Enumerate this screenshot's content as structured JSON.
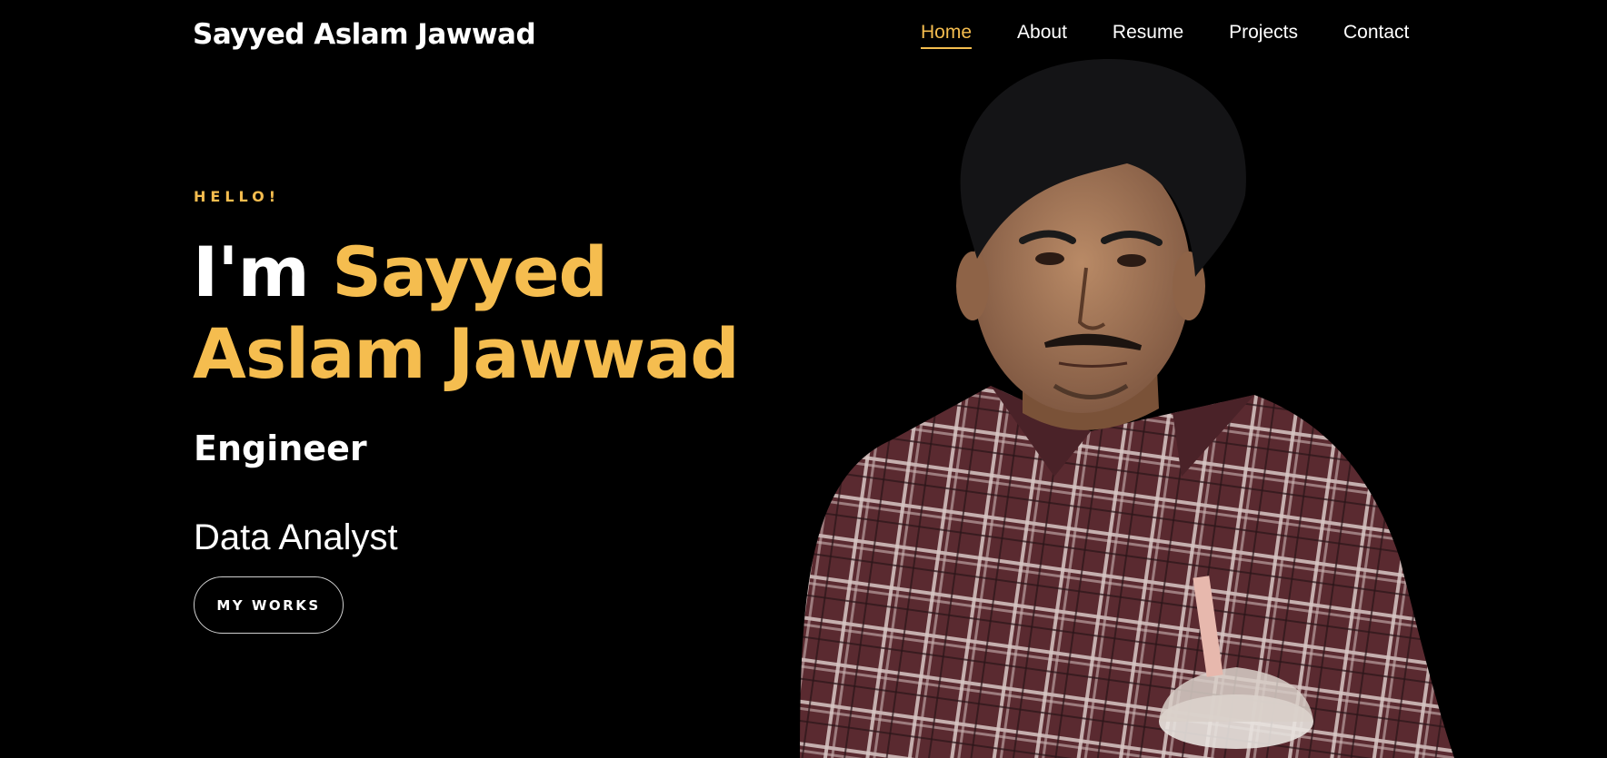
{
  "brand": {
    "name": "Sayyed Aslam Jawwad"
  },
  "nav": {
    "items": [
      {
        "label": "Home",
        "active": true
      },
      {
        "label": "About",
        "active": false
      },
      {
        "label": "Resume",
        "active": false
      },
      {
        "label": "Projects",
        "active": false
      },
      {
        "label": "Contact",
        "active": false
      }
    ]
  },
  "hero": {
    "greeting": "HELLO!",
    "intro": "I'm",
    "name_first": "Sayyed",
    "name_rest": "Aslam Jawwad",
    "role_primary": "Engineer",
    "role_secondary": "Data Analyst",
    "cta_label": "MY WORKS"
  },
  "colors": {
    "background": "#000000",
    "accent": "#f5bd4f",
    "text": "#ffffff"
  },
  "icons": {
    "portrait": "person-photo"
  }
}
